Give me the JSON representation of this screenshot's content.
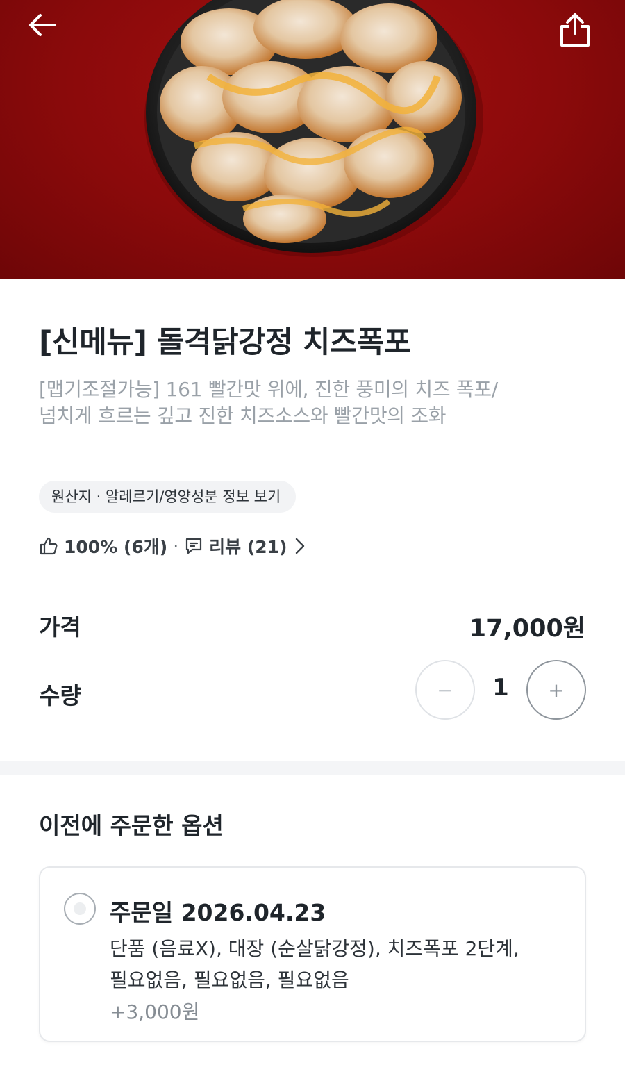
{
  "hero": {
    "image_alt": "돌격닭강정 치즈폭포",
    "back_icon": "arrow-left-icon",
    "share_icon": "share-icon"
  },
  "product": {
    "title": "[신메뉴] 돌격닭강정 치즈폭포",
    "description_line1": "[맵기조절가능] 161 빨간맛 위에, 진한 풍미의 치즈 폭포/",
    "description_line2": "넘치게 흐르는 깊고 진한 치즈소스와 빨간맛의 조화",
    "info_chip": "원산지 · 알레르기/영양성분 정보 보기",
    "like_rate": "100% (6개)",
    "separator": "·",
    "review_label": "리뷰 (21)"
  },
  "price": {
    "label": "가격",
    "value": "17,000원"
  },
  "quantity": {
    "label": "수량",
    "minus": "−",
    "value": "1",
    "plus": "+"
  },
  "previous_options": {
    "title": "이전에 주문한 옵션",
    "items": [
      {
        "date": "주문일 2026.04.23",
        "line1": "단품 (음료X), 대장 (순살닭강정), 치즈폭포 2단계,",
        "line2": "필요없음, 필요없음, 필요없음",
        "extra_price": "+3,000원",
        "selected": false
      }
    ]
  },
  "colors": {
    "hero_bg": "#8b0a0b",
    "text_primary": "#1f252b",
    "text_secondary": "#9aa1a8",
    "chip_bg": "#f2f3f5"
  }
}
